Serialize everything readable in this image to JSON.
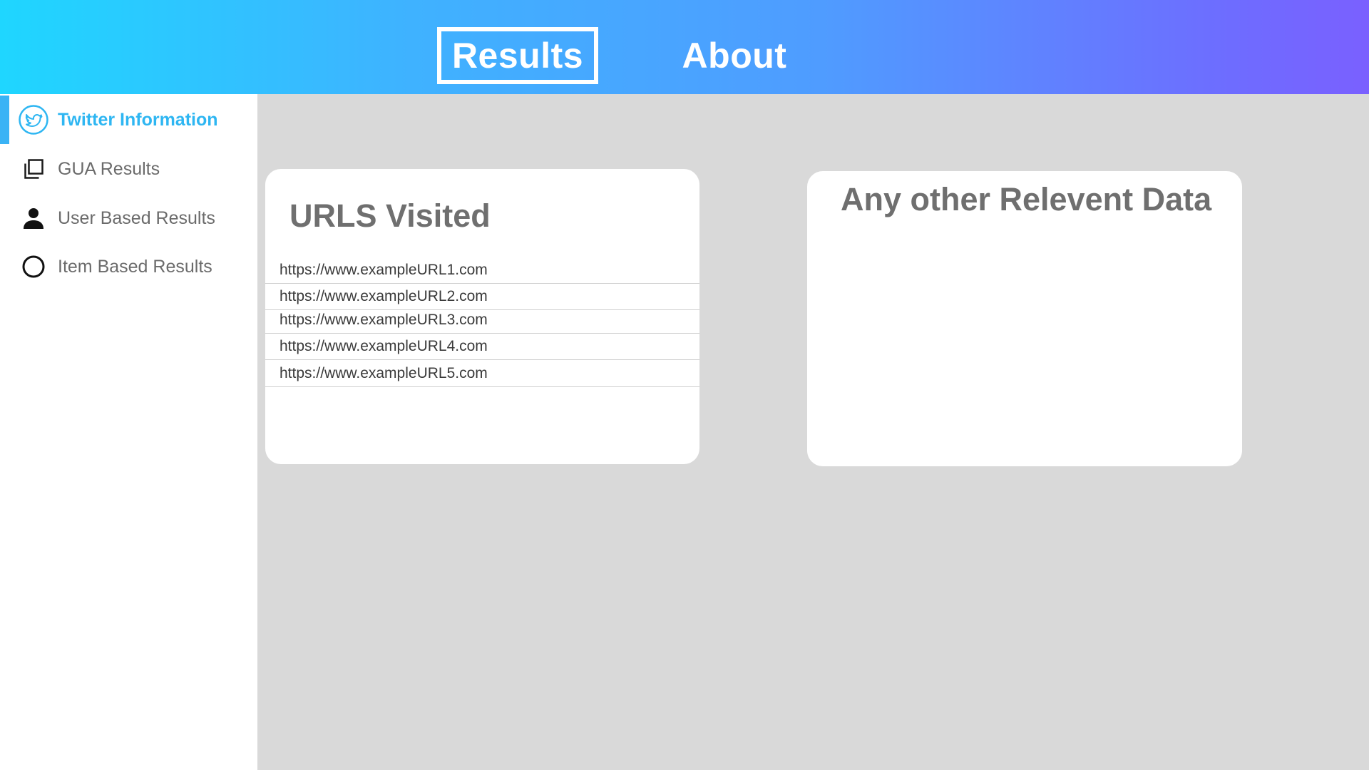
{
  "header": {
    "tabs": [
      {
        "label": "Results",
        "active": true
      },
      {
        "label": "About",
        "active": false
      }
    ],
    "gradient_colors": [
      "#1fd6ff",
      "#7a60ff"
    ]
  },
  "sidebar": {
    "items": [
      {
        "label": "Twitter Information",
        "icon": "twitter-icon",
        "active": true
      },
      {
        "label": "GUA Results",
        "icon": "copy-stack-icon",
        "active": false
      },
      {
        "label": "User Based Results",
        "icon": "user-icon",
        "active": false
      },
      {
        "label": "Item Based Results",
        "icon": "circle-icon",
        "active": false
      }
    ],
    "active_color": "#2eb6f2"
  },
  "main": {
    "urls_card": {
      "title": "URLS Visited",
      "urls": [
        "https://www.exampleURL1.com",
        "https://www.exampleURL2.com",
        "https://www.exampleURL3.com",
        "https://www.exampleURL4.com",
        "https://www.exampleURL5.com"
      ]
    },
    "other_card": {
      "title": "Any other Relevent Data"
    }
  }
}
